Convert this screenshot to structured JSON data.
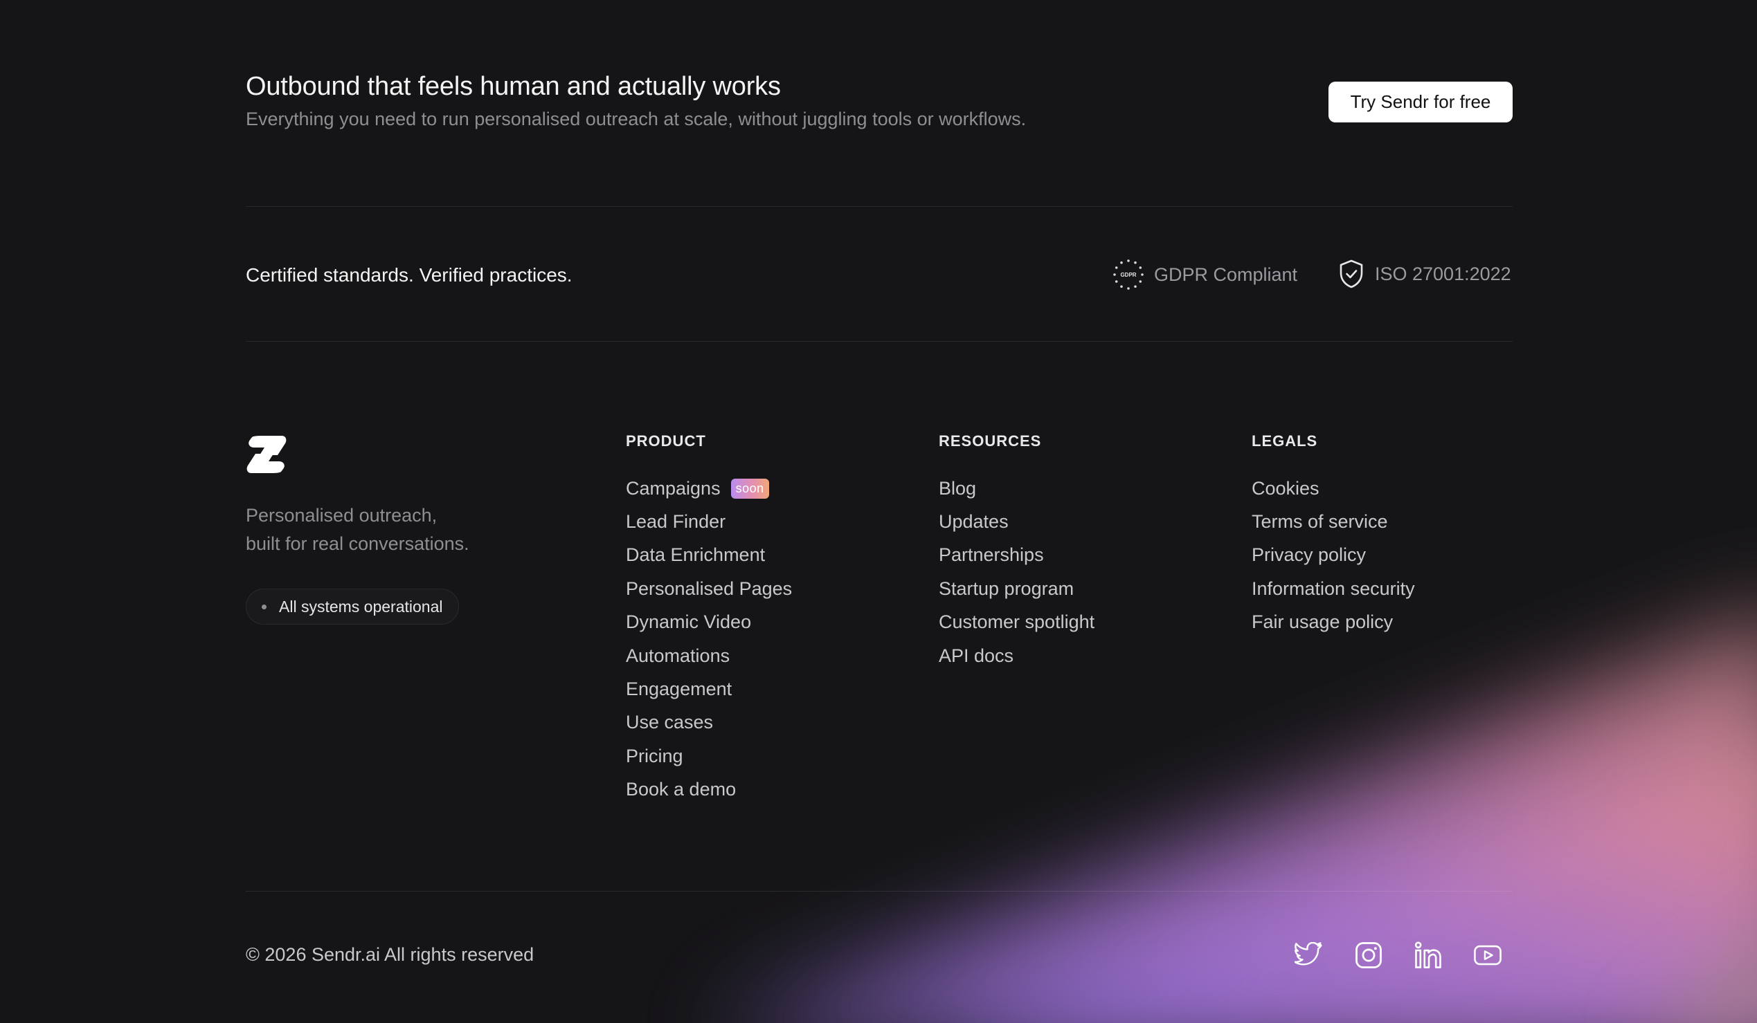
{
  "cta": {
    "title": "Outbound that feels human and actually works",
    "subtitle": "Everything you need to run personalised outreach at scale, without juggling tools or workflows.",
    "button_label": "Try Sendr for free"
  },
  "certifications": {
    "title": "Certified standards. Verified practices.",
    "gdpr_label": "GDPR Compliant",
    "gdpr_icon_text": "GDPR",
    "iso_label": "ISO 27001:2022"
  },
  "brand": {
    "tagline_line1": "Personalised outreach,",
    "tagline_line2": "built for real conversations.",
    "status": "All systems operational"
  },
  "columns": {
    "product": {
      "heading": "PRODUCT",
      "items": [
        "Campaigns",
        "Lead Finder",
        "Data Enrichment",
        "Personalised Pages",
        "Dynamic Video",
        "Automations",
        "Engagement",
        "Use cases",
        "Pricing",
        "Book a demo"
      ],
      "soon_badge": "soon"
    },
    "resources": {
      "heading": "RESOURCES",
      "items": [
        "Blog",
        "Updates",
        "Partnerships",
        "Startup program",
        "Customer spotlight",
        "API docs"
      ]
    },
    "legals": {
      "heading": "LEGALS",
      "items": [
        "Cookies",
        "Terms of service",
        "Privacy policy",
        "Information security",
        "Fair usage policy"
      ]
    }
  },
  "footer": {
    "copyright": "© 2026 Sendr.ai All rights reserved",
    "socials": [
      "twitter-icon",
      "instagram-icon",
      "linkedin-icon",
      "youtube-icon"
    ]
  },
  "colors": {
    "background": "#151517",
    "glow_purple": "#a47ee0",
    "glow_pink": "#e08aa8"
  }
}
